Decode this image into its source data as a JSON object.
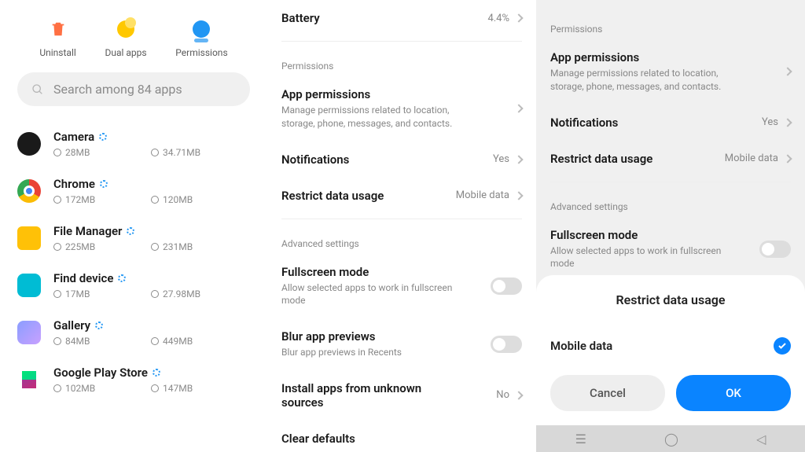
{
  "pane1": {
    "actions": {
      "uninstall": "Uninstall",
      "dual": "Dual apps",
      "permissions": "Permissions"
    },
    "searchPlaceholder": "Search among 84 apps",
    "apps": [
      {
        "name": "Camera",
        "size": "28MB",
        "time": "34.71MB"
      },
      {
        "name": "Chrome",
        "size": "172MB",
        "time": "120MB"
      },
      {
        "name": "File Manager",
        "size": "225MB",
        "time": "231MB"
      },
      {
        "name": "Find device",
        "size": "17MB",
        "time": "27.98MB"
      },
      {
        "name": "Gallery",
        "size": "84MB",
        "time": "449MB"
      },
      {
        "name": "Google Play Store",
        "size": "102MB",
        "time": "147MB"
      }
    ]
  },
  "pane2": {
    "battery": {
      "title": "Battery",
      "value": "4.4%"
    },
    "permSection": "Permissions",
    "appPerm": {
      "title": "App permissions",
      "sub": "Manage permissions related to location, storage, phone, messages, and contacts."
    },
    "notif": {
      "title": "Notifications",
      "value": "Yes"
    },
    "restrict": {
      "title": "Restrict data usage",
      "value": "Mobile data"
    },
    "advSection": "Advanced settings",
    "fullscreen": {
      "title": "Fullscreen mode",
      "sub": "Allow selected apps to work in fullscreen mode"
    },
    "blur": {
      "title": "Blur app previews",
      "sub": "Blur app previews in Recents"
    },
    "install": {
      "title": "Install apps from unknown sources",
      "value": "No"
    },
    "clear": {
      "title": "Clear defaults"
    }
  },
  "pane3": {
    "permSection": "Permissions",
    "appPerm": {
      "title": "App permissions",
      "sub": "Manage permissions related to location, storage, phone, messages, and contacts."
    },
    "notif": {
      "title": "Notifications",
      "value": "Yes"
    },
    "restrict": {
      "title": "Restrict data usage",
      "value": "Mobile data"
    },
    "advSection": "Advanced settings",
    "fullscreen": {
      "title": "Fullscreen mode",
      "sub": "Allow selected apps to work in fullscreen mode"
    },
    "modal": {
      "title": "Restrict data usage",
      "option": "Mobile data",
      "cancel": "Cancel",
      "ok": "OK"
    }
  }
}
